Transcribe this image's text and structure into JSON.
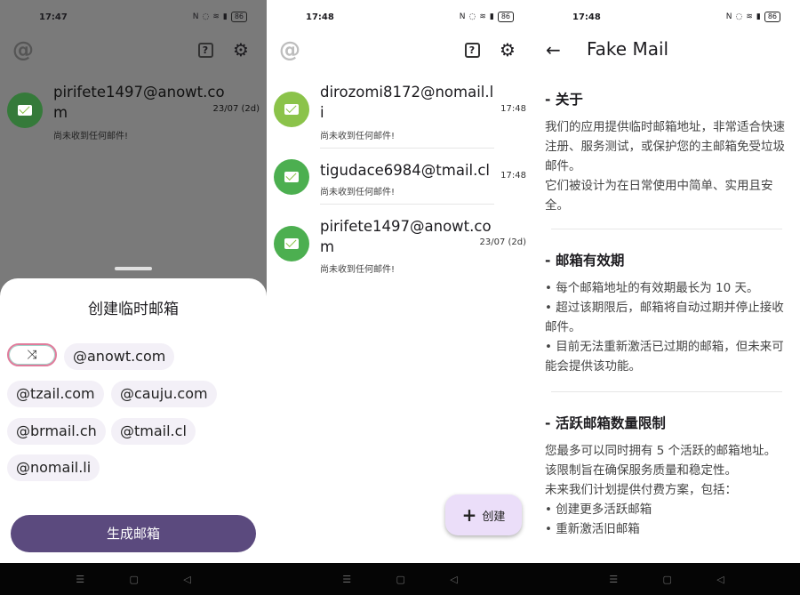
{
  "screen1": {
    "time": "17:47",
    "battery": "86",
    "mail": {
      "address": "pirifete1497@anowt.com",
      "subtitle": "尚未收到任何邮件!",
      "time": "23/07 (2d)"
    },
    "sheet": {
      "title": "创建临时邮箱",
      "domains": [
        "@anowt.com",
        "@tzail.com",
        "@cauju.com",
        "@brmail.ch",
        "@tmail.cl",
        "@nomail.li"
      ],
      "generate_label": "生成邮箱"
    }
  },
  "screen2": {
    "time": "17:48",
    "battery": "86",
    "mails": [
      {
        "address": "dirozomi8172@nomail.li",
        "subtitle": "尚未收到任何邮件!",
        "time": "17:48",
        "color": "#8bc34a"
      },
      {
        "address": "tigudace6984@tmail.cl",
        "subtitle": "尚未收到任何邮件!",
        "time": "17:48",
        "color": "#4caf50"
      },
      {
        "address": "pirifete1497@anowt.com",
        "subtitle": "尚未收到任何邮件!",
        "time": "23/07 (2d)",
        "color": "#4caf50"
      }
    ],
    "fab_label": "创建"
  },
  "screen3": {
    "time": "17:48",
    "battery": "86",
    "title": "Fake Mail",
    "sections": [
      {
        "head": "- 关于",
        "lines": [
          "我们的应用提供临时邮箱地址，非常适合快速注册、服务测试，或保护您的主邮箱免受垃圾邮件。",
          "它们被设计为在日常使用中简单、实用且安全。"
        ]
      },
      {
        "head": "- 邮箱有效期",
        "lines": [
          "• 每个邮箱地址的有效期最长为 10 天。",
          "• 超过该期限后，邮箱将自动过期并停止接收邮件。",
          "• 目前无法重新激活已过期的邮箱，但未来可能会提供该功能。"
        ]
      },
      {
        "head": "- 活跃邮箱数量限制",
        "lines": [
          "您最多可以同时拥有 5 个活跃的邮箱地址。",
          "该限制旨在确保服务质量和稳定性。",
          "未来我们计划提供付费方案，包括：",
          "• 创建更多活跃邮箱",
          "• 重新激活旧邮箱"
        ]
      }
    ]
  }
}
